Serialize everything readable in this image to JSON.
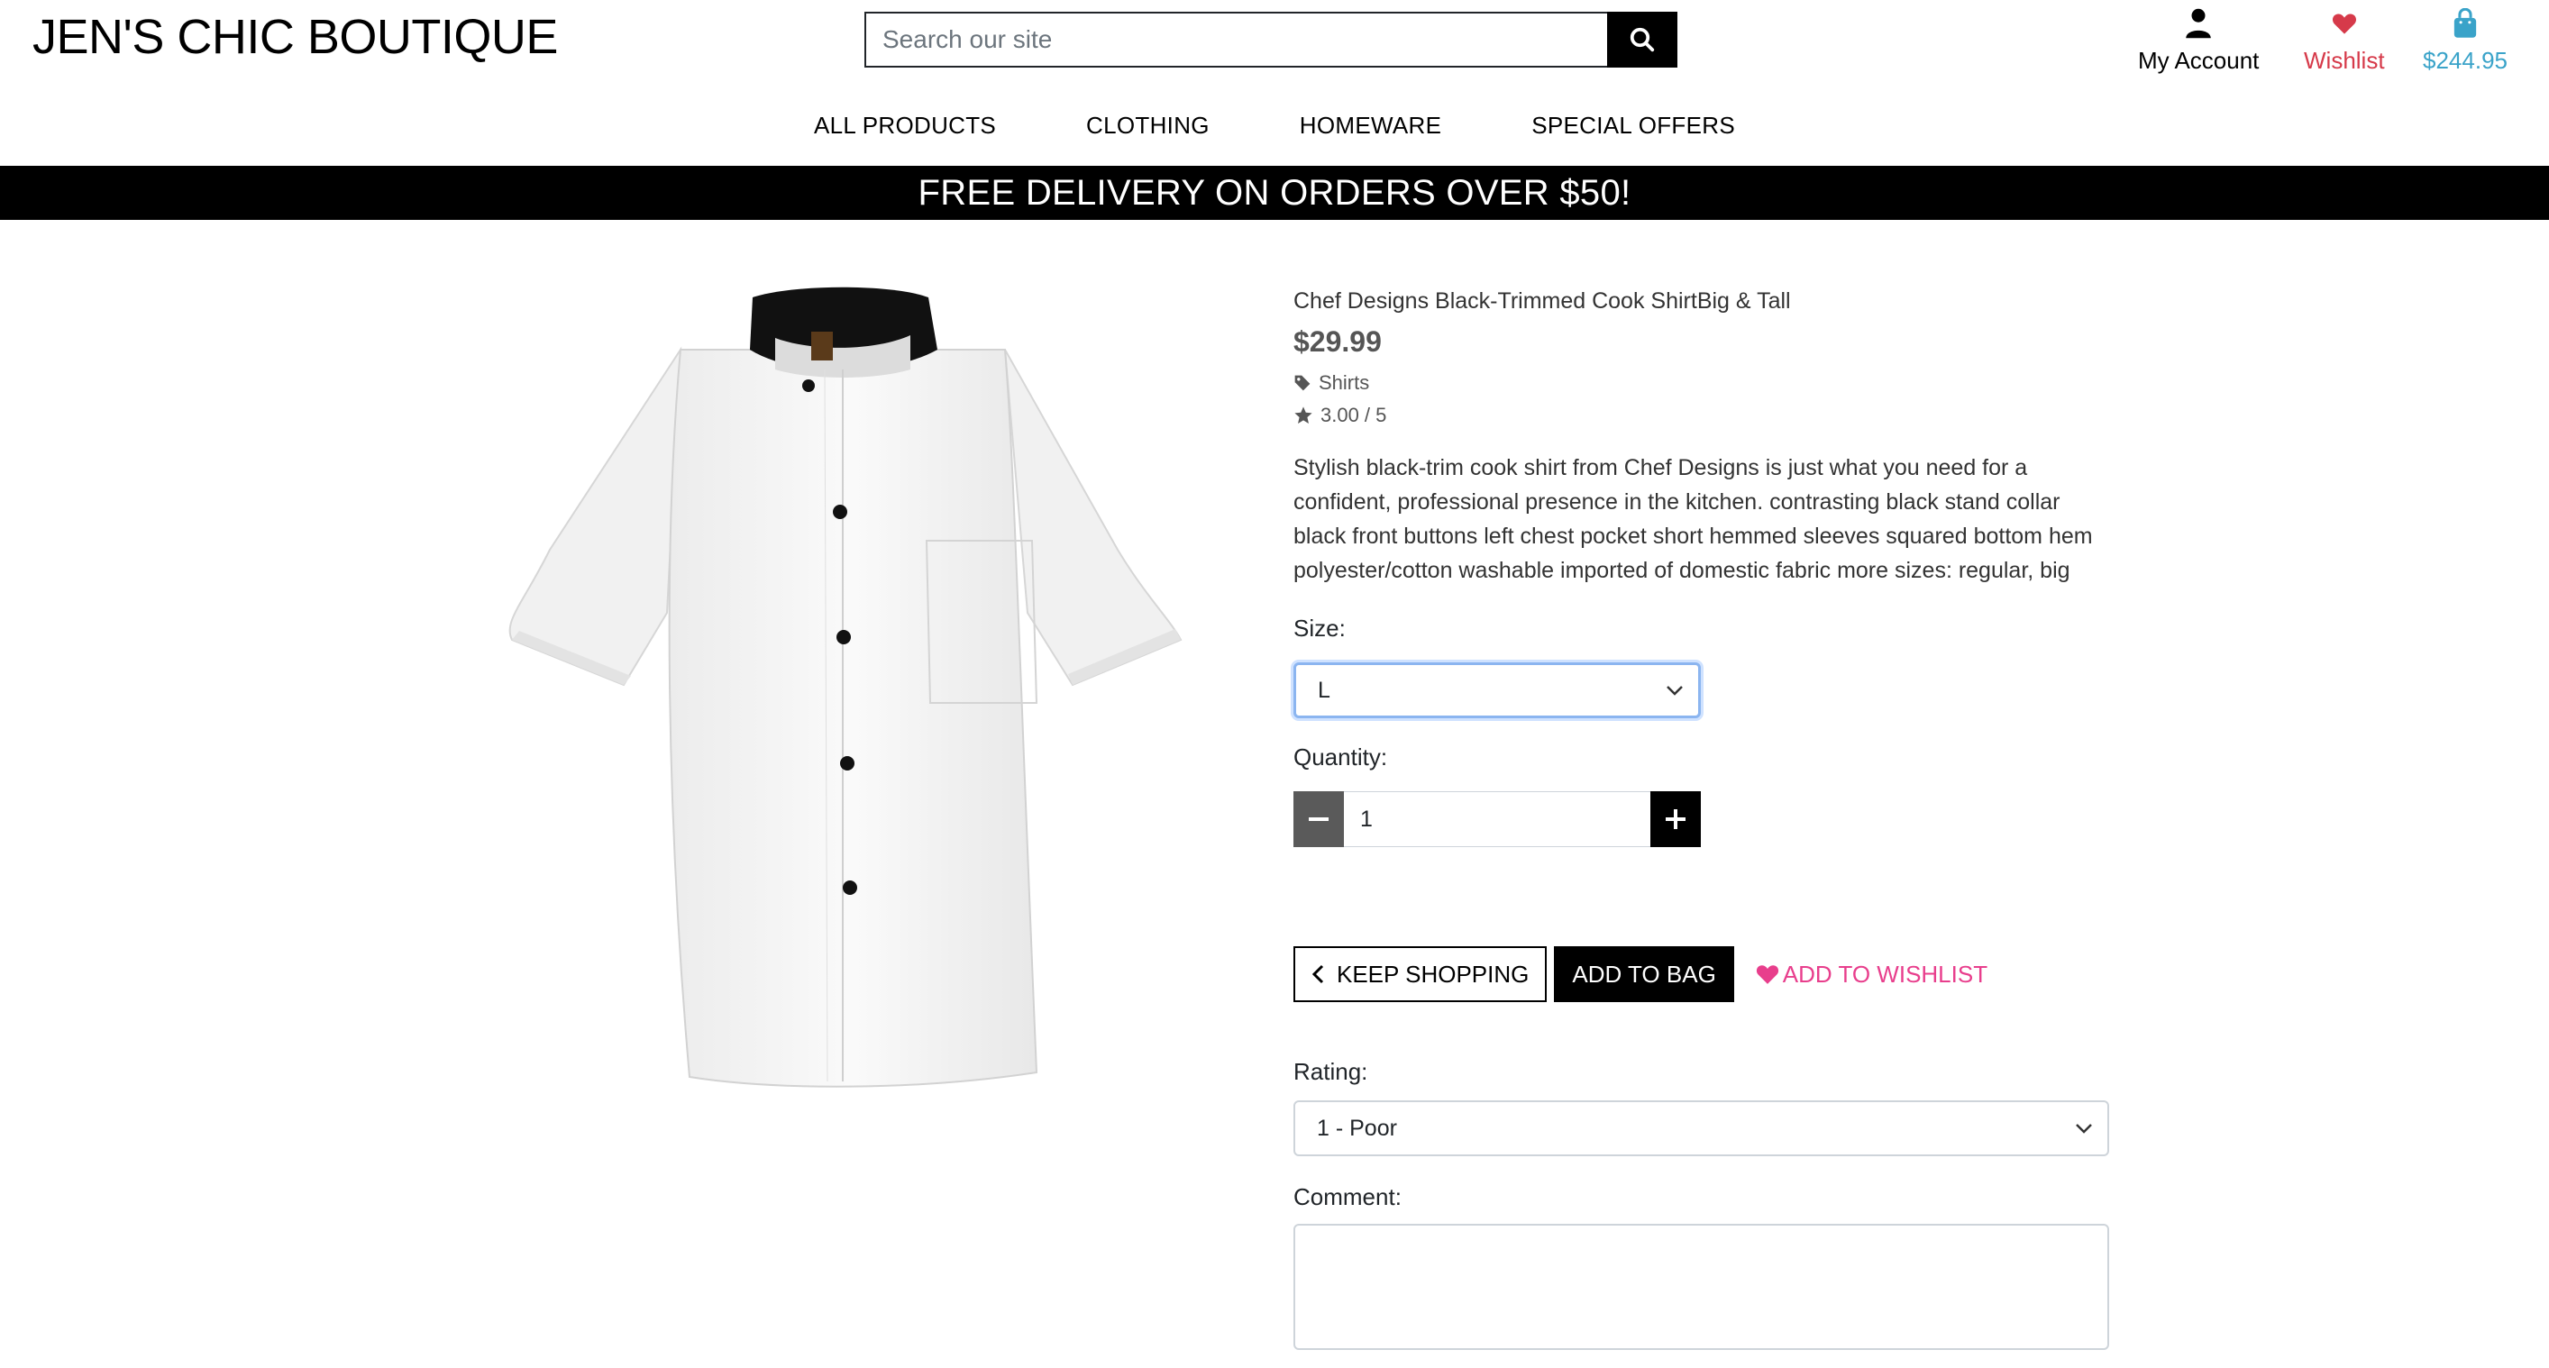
{
  "header": {
    "logo": "JEN'S CHIC BOUTIQUE",
    "search_placeholder": "Search our site",
    "account_label": "My Account",
    "wishlist_label": "Wishlist",
    "bag_total": "$244.95",
    "colors": {
      "wishlist": "#d63a4a",
      "bag": "#3aa3c9"
    }
  },
  "nav": {
    "items": [
      "ALL PRODUCTS",
      "CLOTHING",
      "HOMEWARE",
      "SPECIAL OFFERS"
    ]
  },
  "banner": "FREE DELIVERY ON ORDERS OVER $50!",
  "product": {
    "name": "Chef Designs Black-Trimmed Cook ShirtBig & Tall",
    "price": "$29.99",
    "category": "Shirts",
    "rating": "3.00 / 5",
    "description": "Stylish black-trim cook shirt from Chef Designs is just what you need for a confident, professional presence in the kitchen. contrasting black stand collar black front buttons left chest pocket short hemmed sleeves squared bottom hem polyester/cotton washable imported of domestic fabric more sizes: regular, big",
    "size_label": "Size:",
    "size_value": "L",
    "quantity_label": "Quantity:",
    "quantity_value": "1"
  },
  "actions": {
    "keep_shopping": "KEEP SHOPPING",
    "add_to_bag": "ADD TO BAG",
    "add_to_wishlist": "ADD TO WISHLIST",
    "wishlist_color": "#e83e8c"
  },
  "review": {
    "rating_label": "Rating:",
    "rating_value": "1 - Poor",
    "comment_label": "Comment:"
  }
}
